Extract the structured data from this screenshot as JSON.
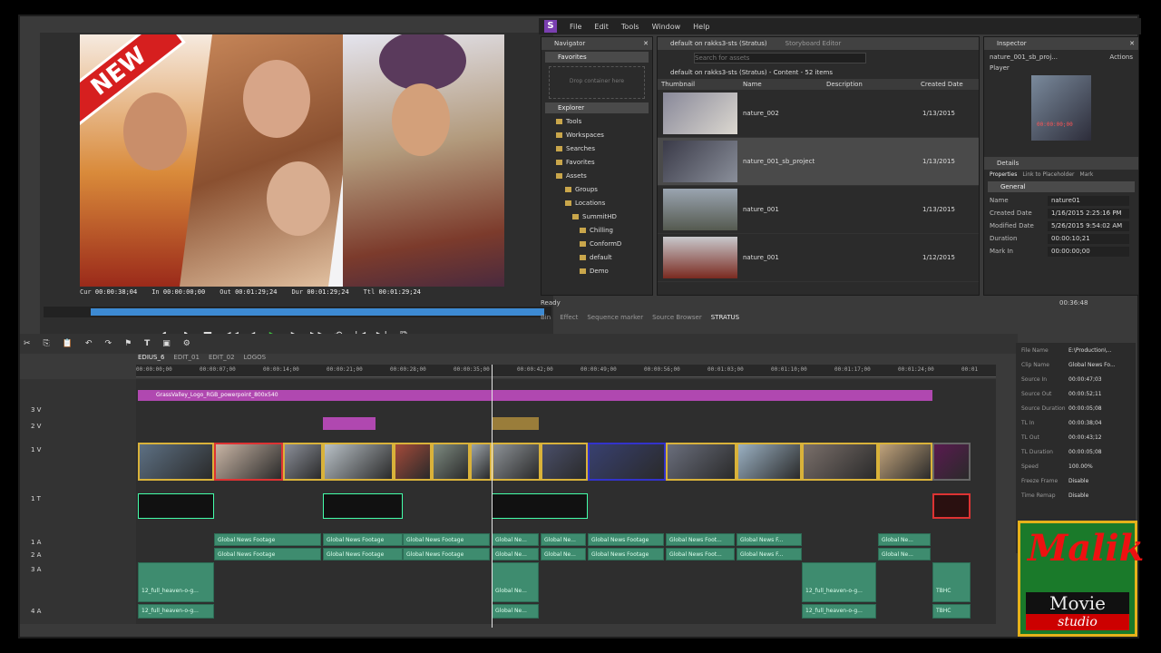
{
  "preview": {
    "badge": "NEW",
    "timecodes": [
      {
        "label": "Cur",
        "value": "00:00:38;04"
      },
      {
        "label": "In",
        "value": "00:00:00;00"
      },
      {
        "label": "Out",
        "value": "00:01:29;24"
      },
      {
        "label": "Dur",
        "value": "00:01:29;24"
      },
      {
        "label": "Ttl",
        "value": "00:01:29;24"
      }
    ],
    "scrub_progress": 0.46
  },
  "menubar": {
    "logo": "S",
    "items": [
      "File",
      "Edit",
      "Tools",
      "Window",
      "Help"
    ]
  },
  "navigator": {
    "title": "Navigator",
    "favorites_header": "Favorites",
    "favorites_hint": "Drop container here",
    "explorer_header": "Explorer",
    "items": [
      "Tools",
      "Workspaces",
      "Searches",
      "Favorites",
      "Assets",
      "Groups",
      "Locations",
      "SummitHD",
      "Chilling",
      "ConformD",
      "default",
      "Demo"
    ]
  },
  "browser": {
    "tab1": "default on rakks3-sts (Stratus)",
    "tab2": "Storyboard Editor",
    "search_placeholder": "Search for assets",
    "location": "default on rakks3-sts (Stratus) - Content - 52 items",
    "columns": [
      "Thumbnail",
      "Name",
      "Description",
      "Created Date"
    ],
    "rows": [
      {
        "name": "nature_002",
        "date": "1/13/2015"
      },
      {
        "name": "nature_001_sb_project",
        "date": "1/13/2015"
      },
      {
        "name": "nature_001",
        "date": "1/13/2015"
      },
      {
        "name": "nature_001",
        "date": "1/12/2015"
      }
    ]
  },
  "inspector": {
    "title": "Inspector",
    "asset": "nature_001_sb_proj...",
    "actions": "Actions",
    "player_label": "Player",
    "player_tc": "00:00:00;00",
    "details_label": "Details",
    "tabs": [
      "Properties",
      "Link to Placeholder",
      "Mark"
    ],
    "group": "General",
    "props": [
      {
        "k": "Name",
        "v": "nature01"
      },
      {
        "k": "Created Date",
        "v": "1/16/2015 2:25:16 PM"
      },
      {
        "k": "Modified Date",
        "v": "5/26/2015 9:54:02 AM"
      },
      {
        "k": "Duration",
        "v": "00:00:10;21"
      },
      {
        "k": "Mark In",
        "v": "00:00:00;00"
      }
    ]
  },
  "status": {
    "ready": "Ready",
    "clock": "00:36:48"
  },
  "lower_tabs": [
    "Bin",
    "Effect",
    "Sequence marker",
    "Source Browser",
    "STRATUS"
  ],
  "timeline": {
    "sequence_tabs": [
      "EDIUS_6",
      "EDIT_01",
      "EDIT_02",
      "LOGOS"
    ],
    "tracks": [
      "3 V",
      "2 V",
      "1 V",
      "1 T",
      "1 A",
      "2 A",
      "3 A",
      "4 A"
    ],
    "ruler": [
      "00:00:00;00",
      "00:00:07;00",
      "00:00:14;00",
      "00:00:21;00",
      "00:00:28;00",
      "00:00:35;00",
      "00:00:42;00",
      "00:00:49;00",
      "00:00:56;00",
      "00:01:03;00",
      "00:01:10;00",
      "00:01:17;00",
      "00:01:24;00",
      "00:01"
    ],
    "v3_clip": "GrassValley_Logo_RGB_powerpoint_800x540",
    "audio_a1": [
      "Global News Footage",
      "Global News Footage",
      "Global News Footage",
      "Global Ne...",
      "Global Ne...",
      "Global News Footage",
      "Global News Foot...",
      "Global News F...",
      "Global Ne..."
    ],
    "audio_a2": [
      "Global News Footage",
      "Global News Footage",
      "Global News Footage",
      "Global Ne...",
      "Global Ne...",
      "Global News Footage",
      "Global News Foot...",
      "Global News F...",
      "Global Ne..."
    ],
    "audio_a3": [
      "12_full_heaven-o-g...",
      "Global Ne...",
      "12_full_heaven-o-g...",
      "TBHC"
    ],
    "audio_a4": [
      "12_full_heaven-o-g...",
      "Global Ne...",
      "12_full_heaven-o-g...",
      "TBHC"
    ]
  },
  "clip_info": [
    {
      "k": "File Name",
      "v": "E:\\Production\\..."
    },
    {
      "k": "Clip Name",
      "v": "Global News Fo..."
    },
    {
      "k": "Source In",
      "v": "00:00:47;03"
    },
    {
      "k": "Source Out",
      "v": "00:00:52;11"
    },
    {
      "k": "Source Duration",
      "v": "00:00:05;08"
    },
    {
      "k": "TL In",
      "v": "00:00:38;04"
    },
    {
      "k": "TL Out",
      "v": "00:00:43;12"
    },
    {
      "k": "TL Duration",
      "v": "00:00:05;08"
    },
    {
      "k": "Speed",
      "v": "100.00%"
    },
    {
      "k": "Freeze Frame",
      "v": "Disable"
    },
    {
      "k": "Time Remap",
      "v": "Disable"
    }
  ],
  "watermark": {
    "line1": "Malik",
    "line2": "Movie",
    "line3": "studio"
  },
  "colors": {
    "accent_blue": "#3d8ad3",
    "audio_green": "#3e8c6f",
    "title_pink": "#b048b0",
    "play_green": "#3fc13f"
  }
}
